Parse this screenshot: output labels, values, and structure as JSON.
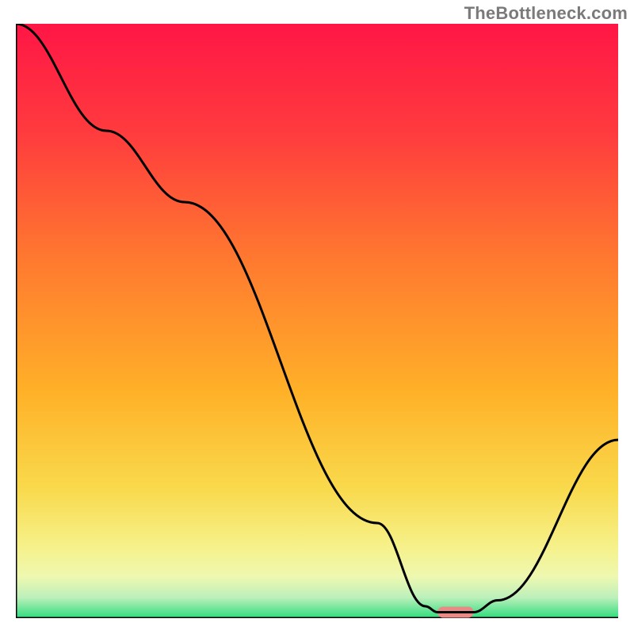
{
  "watermark": "TheBottleneck.com",
  "chart_data": {
    "type": "line",
    "title": "",
    "xlabel": "",
    "ylabel": "",
    "xlim": [
      0,
      100
    ],
    "ylim": [
      0,
      100
    ],
    "grid": false,
    "x": [
      0,
      15,
      28,
      60,
      68,
      70,
      74,
      76,
      80,
      100
    ],
    "values": [
      100,
      82,
      70,
      16,
      2,
      1,
      1,
      1,
      3,
      30
    ],
    "curve_color": "#000000",
    "gradient_stops": [
      {
        "offset": 0.0,
        "color": "#ff1646"
      },
      {
        "offset": 0.18,
        "color": "#ff3a3e"
      },
      {
        "offset": 0.4,
        "color": "#ff7a2f"
      },
      {
        "offset": 0.62,
        "color": "#ffb128"
      },
      {
        "offset": 0.78,
        "color": "#f9d94b"
      },
      {
        "offset": 0.88,
        "color": "#f6f18a"
      },
      {
        "offset": 0.93,
        "color": "#eef8b0"
      },
      {
        "offset": 0.965,
        "color": "#bdf0bb"
      },
      {
        "offset": 1.0,
        "color": "#2fdc7e"
      }
    ],
    "marker": {
      "x_start": 70,
      "x_end": 76,
      "y": 1,
      "color": "#e98a87"
    },
    "axes": {
      "color": "#000000",
      "width": 3
    }
  }
}
